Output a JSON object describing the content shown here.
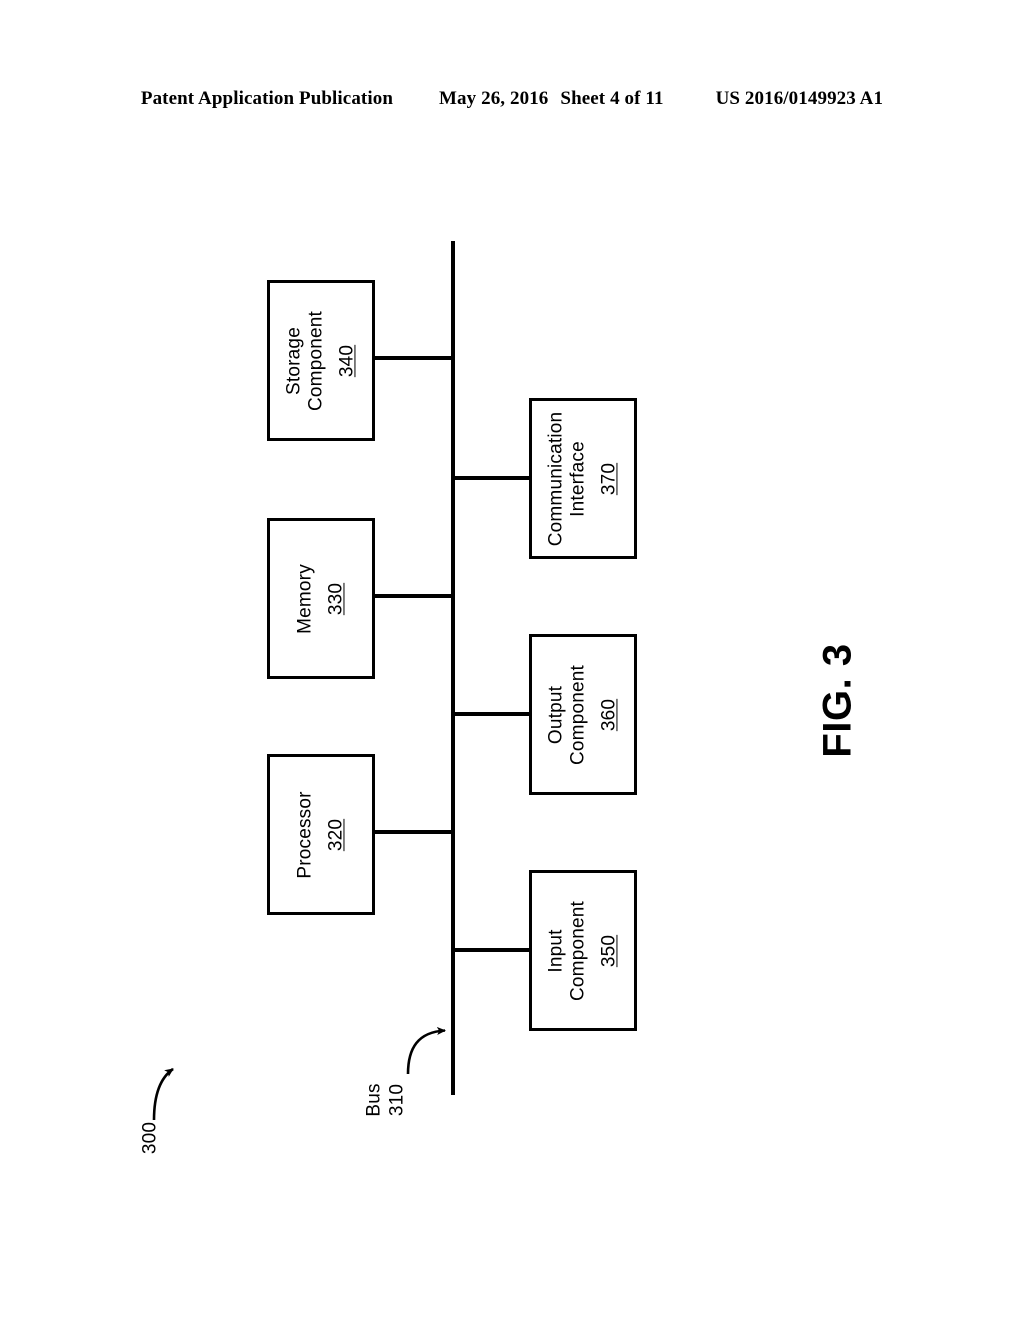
{
  "header": {
    "publication": "Patent Application Publication",
    "date": "May 26, 2016",
    "sheet": "Sheet 4 of 11",
    "patent_number": "US 2016/0149923 A1"
  },
  "figure": {
    "caption": "FIG. 3",
    "diagram_ref": "300",
    "bus": {
      "label": "Bus",
      "ref": "310"
    },
    "components": [
      {
        "id": "storage-component",
        "name": "Storage\nComponent",
        "name_lines": [
          "Storage",
          "Component"
        ],
        "ref": "340",
        "side": "left"
      },
      {
        "id": "memory",
        "name": "Memory",
        "name_lines": [
          "Memory"
        ],
        "ref": "330",
        "side": "left"
      },
      {
        "id": "processor",
        "name": "Processor",
        "name_lines": [
          "Processor"
        ],
        "ref": "320",
        "side": "left"
      },
      {
        "id": "communication-interface",
        "name": "Communication\nInterface",
        "name_lines": [
          "Communication",
          "Interface"
        ],
        "ref": "370",
        "side": "right"
      },
      {
        "id": "output-component",
        "name": "Output\nComponent",
        "name_lines": [
          "Output",
          "Component"
        ],
        "ref": "360",
        "side": "right"
      },
      {
        "id": "input-component",
        "name": "Input\nComponent",
        "name_lines": [
          "Input",
          "Component"
        ],
        "ref": "350",
        "side": "right"
      }
    ]
  },
  "colors": {
    "ink": "#000000",
    "paper": "#ffffff"
  }
}
